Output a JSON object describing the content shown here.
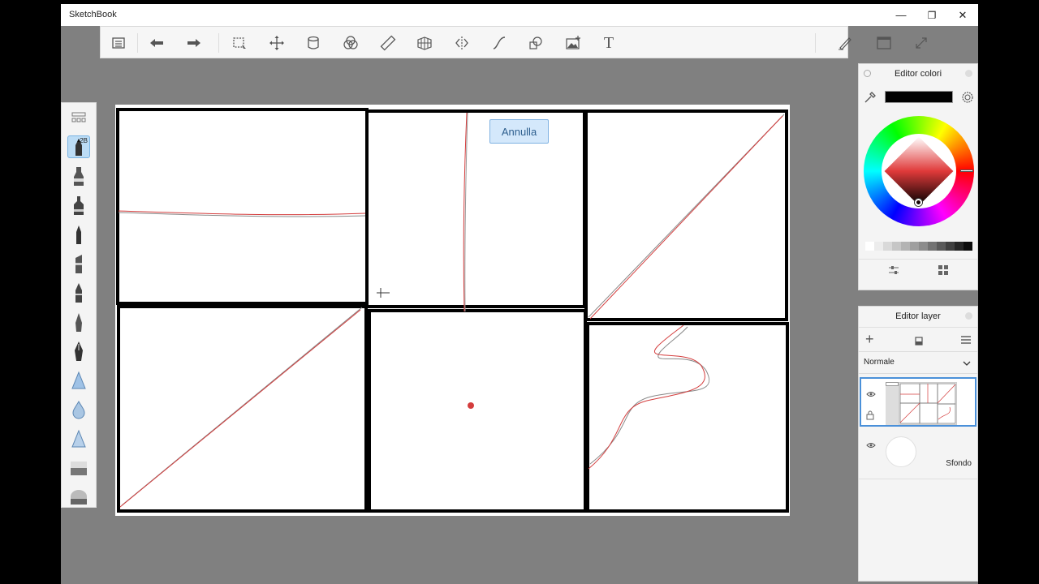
{
  "app": {
    "title": "SketchBook"
  },
  "window_controls": {
    "minimize": "—",
    "restore": "❐",
    "close": "✕"
  },
  "toolbar": {
    "text_tool": "T",
    "tools": [
      "list-icon",
      "undo-icon",
      "redo-icon",
      "select-icon",
      "move-icon",
      "fill-icon",
      "symmetry-circles-icon",
      "ruler-icon",
      "perspective-icon",
      "symmetry-icon",
      "curve-icon",
      "shapes-icon",
      "image-icon",
      "text-icon",
      "brush-mode-icon",
      "canvas-view-icon",
      "fullscreen-icon"
    ]
  },
  "brushes": {
    "selected_size": "2B",
    "items": [
      "brush-grid-icon",
      "pencil-icon",
      "marker-icon",
      "felt-tip-icon",
      "ballpoint-icon",
      "chisel-icon",
      "pen-icon",
      "fine-pen-icon",
      "ink-pen-icon",
      "airbrush-icon",
      "water-drop-icon",
      "triangle-brush-icon",
      "eraser-icon",
      "soft-eraser-icon"
    ]
  },
  "canvas": {
    "undo_label": "Annulla",
    "stroke_color": "#d43d3d"
  },
  "color_editor": {
    "title": "Editor colori",
    "current_color": "#000000",
    "swatches": [
      "#ffffff",
      "#ececec",
      "#d9d9d9",
      "#c6c6c6",
      "#b3b3b3",
      "#9f9f9f",
      "#8c8c8c",
      "#737373",
      "#5a5a5a",
      "#404040",
      "#262626",
      "#0d0d0d"
    ]
  },
  "layer_editor": {
    "title": "Editor layer",
    "blend_mode": "Normale",
    "background_layer": "Sfondo"
  }
}
